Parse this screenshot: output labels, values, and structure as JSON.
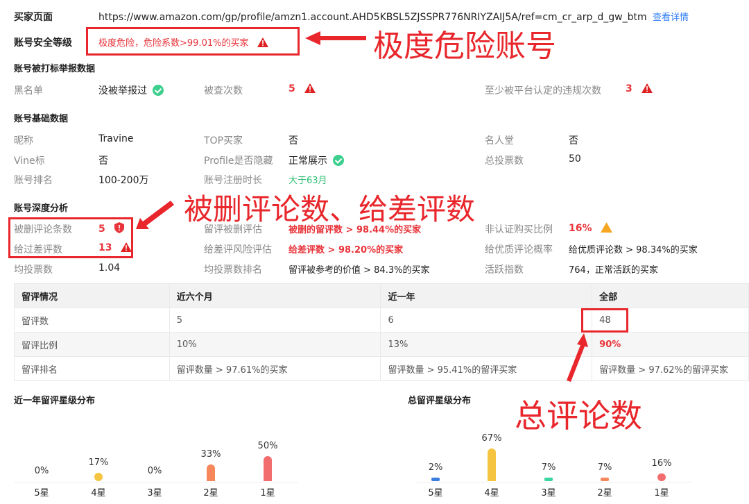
{
  "header": {
    "buyer_page_label": "买家页面",
    "url": "https://www.amazon.com/gp/profile/amzn1.account.AHD5KBSL5ZJSSPR776NRIYZAIJ5A/ref=cm_cr_arp_d_gw_btm",
    "view_details": "查看详情",
    "security_label": "账号安全等级",
    "security_value": "极度危险，危险系数>99.01%的买家"
  },
  "report": {
    "title": "账号被打标举报数据",
    "blacklist_label": "黑名单",
    "blacklist_value": "没被举报过",
    "checked_label": "被查次数",
    "checked_value": "5",
    "violation_label": "至少被平台认定的违规次数",
    "violation_value": "3"
  },
  "basic": {
    "title": "账号基础数据",
    "rows": [
      {
        "l1": "昵称",
        "v1": "Travine",
        "l2": "TOP买家",
        "v2": "否",
        "l3": "名人堂",
        "v3": "否"
      },
      {
        "l1": "Vine标",
        "v1": "否",
        "l2": "Profile是否隐藏",
        "v2": "正常展示",
        "l3": "总投票数",
        "v3": "50"
      },
      {
        "l1": "账号排名",
        "v1": "100-200万",
        "l2": "账号注册时长",
        "v2": "大于63月",
        "l3": "",
        "v3": ""
      }
    ]
  },
  "deep": {
    "title": "账号深度分析",
    "deleted_label": "被删评论条数",
    "deleted_value": "5",
    "deleted_eval_label": "留评被删评估",
    "deleted_eval_value": "被删的留评数 > 98.44%的买家",
    "unverified_label": "非认证购买比例",
    "unverified_value": "16%",
    "bad_label": "给过差评数",
    "bad_value": "13",
    "bad_risk_label": "给差评风险评估",
    "bad_risk_value": "给差评数 > 98.20%的买家",
    "quality_label": "给优质评论概率",
    "quality_value": "给优质评论数 > 98.34%的买家",
    "avg_label": "均投票数",
    "avg_value": "1.04",
    "avg_rank_label": "均投票数排名",
    "avg_rank_value": "留评被参考的价值 > 84.3%的买家",
    "active_label": "活跃指数",
    "active_value": "764，正常活跃的买家"
  },
  "table": {
    "headers": [
      "留评情况",
      "近六个月",
      "近一年",
      "全部"
    ],
    "rows": [
      [
        "留评数",
        "5",
        "6",
        "48"
      ],
      [
        "留评比例",
        "10%",
        "13%",
        "90%"
      ],
      [
        "留评排名",
        "留评数量 > 97.61%的买家",
        "留评数量 > 95.41%的留评买家",
        "留评数量 > 97.62%的留评买家"
      ]
    ]
  },
  "chart_data": [
    {
      "type": "bar",
      "title": "近一年留评星级分布",
      "categories": [
        "5星",
        "4星",
        "3星",
        "2星",
        "1星"
      ],
      "values": [
        0,
        17,
        0,
        33,
        50
      ],
      "colors": [
        "#f5c542",
        "#f5c542",
        "#f5c542",
        "#f5875a",
        "#f26d6d"
      ]
    },
    {
      "type": "bar",
      "title": "总留评星级分布",
      "categories": [
        "5星",
        "4星",
        "3星",
        "2星",
        "1星"
      ],
      "values": [
        2,
        67,
        7,
        7,
        16
      ],
      "colors": [
        "#3b7de0",
        "#f5c542",
        "#3ad6a0",
        "#f5875a",
        "#f26d6d"
      ]
    }
  ],
  "annotations": {
    "danger": "极度危险账号",
    "deleted": "被删评论数、给差评数",
    "total": "总评论数"
  },
  "colors": {
    "accent_red": "#e8343a",
    "link_blue": "#2f7df6",
    "ok_green": "#3ccf8e"
  }
}
